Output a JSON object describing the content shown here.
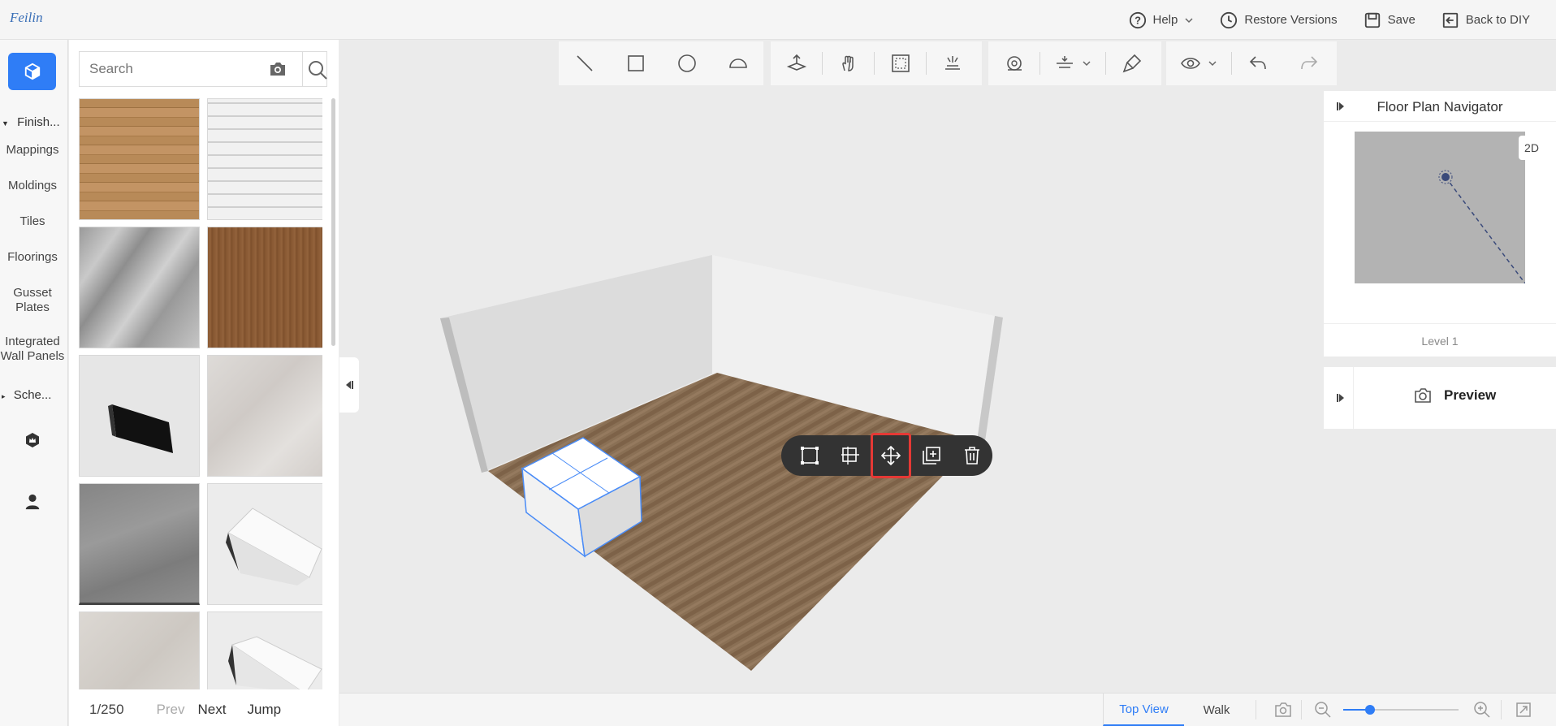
{
  "app": {
    "logo_text": "Feilin"
  },
  "topnav": {
    "help_label": "Help",
    "restore_label": "Restore Versions",
    "save_label": "Save",
    "back_label": "Back to DIY"
  },
  "leftrail": {
    "section_finish": "Finish...",
    "items": [
      "Mappings",
      "Moldings",
      "Tiles",
      "Floorings",
      "Gusset Plates",
      "Integrated Wall Panels"
    ],
    "section_schemes": "Sche..."
  },
  "search": {
    "placeholder": "Search"
  },
  "pager": {
    "page": "1/250",
    "prev": "Prev",
    "next": "Next",
    "jump": "Jump"
  },
  "navigator": {
    "title": "Floor Plan Navigator",
    "mode_2d": "2D",
    "level": "Level 1"
  },
  "preview": {
    "label": "Preview"
  },
  "statusbar": {
    "top_view": "Top View",
    "walk": "Walk",
    "zoom_fraction": 0.23
  },
  "colors": {
    "accent": "#2f7df6",
    "highlight": "#e53935",
    "selection": "#4a8cf7"
  }
}
